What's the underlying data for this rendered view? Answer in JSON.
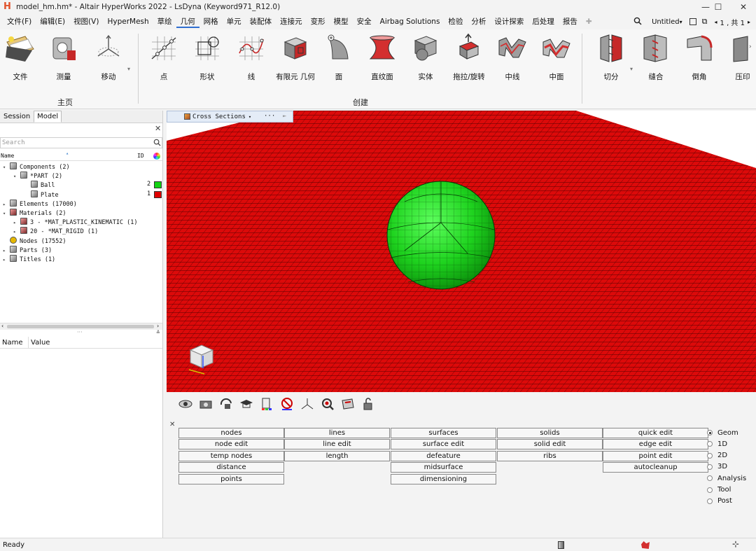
{
  "window": {
    "title": "model_hm.hm* - Altair HyperWorks 2022 - LsDyna (Keyword971_R12.0)",
    "controls": [
      "—",
      "☐",
      "✕"
    ]
  },
  "menu": {
    "items": [
      "文件(F)",
      "编辑(E)",
      "视图(V)",
      "HyperMesh",
      "草绘",
      "几何",
      "网格",
      "单元",
      "装配体",
      "连接元",
      "变形",
      "模型",
      "安全",
      "Airbag Solutions",
      "检验",
      "分析",
      "设计探索",
      "后处理",
      "报告"
    ],
    "active": "几何",
    "session_name": "Untitled",
    "page_counter": "1 , 共 1"
  },
  "ribbon": {
    "groups": [
      {
        "label": "主页",
        "buttons": [
          "文件",
          "测量",
          "移动"
        ]
      },
      {
        "label": "创建",
        "buttons": [
          "点",
          "形状",
          "线",
          "有限元 几何",
          "面",
          "直纹面",
          "实体",
          "拖拉/旋转",
          "中线",
          "中面"
        ]
      },
      {
        "label": "",
        "buttons": [
          "切分",
          "缝合",
          "倒角",
          "压印"
        ]
      }
    ]
  },
  "left_panel": {
    "tabs": [
      "Session",
      "Model"
    ],
    "active_tab": "Model",
    "search_placeholder": "Search",
    "columns": [
      "Name",
      "ID"
    ],
    "tree": [
      {
        "level": 0,
        "expand": "▾",
        "label": "Components  (2)"
      },
      {
        "level": 1,
        "expand": "▾",
        "label": "*PART  (2)"
      },
      {
        "level": 2,
        "expand": "",
        "label": "Ball",
        "id": "2",
        "color": "#12d212"
      },
      {
        "level": 2,
        "expand": "",
        "label": "Plate",
        "id": "1",
        "color": "#e00000"
      },
      {
        "level": 0,
        "expand": "▸",
        "label": "Elements  (17000)"
      },
      {
        "level": 0,
        "expand": "▾",
        "label": "Materials  (2)"
      },
      {
        "level": 1,
        "expand": "▸",
        "label": "3 - *MAT_PLASTIC_KINEMATIC  (1)"
      },
      {
        "level": 1,
        "expand": "▸",
        "label": "20 - *MAT_RIGID  (1)"
      },
      {
        "level": 0,
        "expand": "",
        "label": "Nodes  (17552)"
      },
      {
        "level": 0,
        "expand": "▸",
        "label": "Parts  (3)"
      },
      {
        "level": 0,
        "expand": "▸",
        "label": "Titles  (1)"
      }
    ],
    "properties_columns": [
      "Name",
      "Value"
    ]
  },
  "viewport": {
    "toolbar_label": "Cross Sections",
    "more": "···",
    "plate_color": "#dc0a0a",
    "mesh_color": "#3a0000",
    "ball_color": "#1ed21e",
    "background": "#ffffff"
  },
  "view_tools": [
    "visualization-icon",
    "camera-icon",
    "rotate-icon",
    "graduation-icon",
    "component-color-icon",
    "no-entry-icon",
    "axis-icon",
    "zoom-icon",
    "shade-icon",
    "lock-icon"
  ],
  "hm_panel": {
    "close": "✕",
    "columns": [
      [
        "nodes",
        "node edit",
        "temp nodes",
        "distance",
        "points"
      ],
      [
        "lines",
        "line edit",
        "length"
      ],
      [
        "surfaces",
        "surface edit",
        "defeature",
        "midsurface",
        "dimensioning"
      ],
      [
        "solids",
        "solid edit",
        "ribs"
      ],
      [
        "quick edit",
        "edge edit",
        "point edit",
        "autocleanup"
      ]
    ],
    "modes": [
      "Geom",
      "1D",
      "2D",
      "3D",
      "Analysis",
      "Tool",
      "Post"
    ],
    "selected_mode": "Geom"
  },
  "status": {
    "text": "Ready"
  }
}
